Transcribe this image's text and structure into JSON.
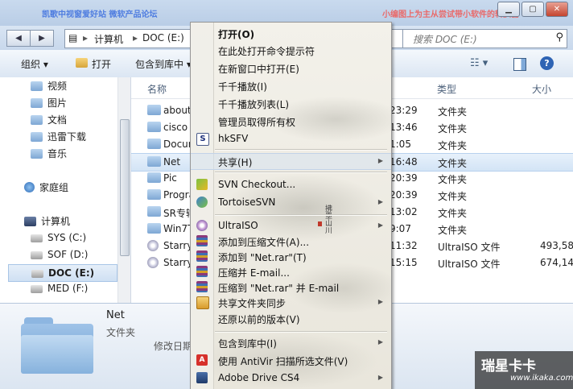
{
  "title_bar": {
    "left_text": "凯歌中视窗爱好站 微软产品论坛",
    "right_text": "小编图上为主从尝试带小软件的转换器",
    "minimize": "▁",
    "maximize": "▢",
    "close": "✕"
  },
  "address": {
    "back": "◀",
    "forward": "▶",
    "crumbs": [
      "计算机",
      "DOC (E:)"
    ],
    "search_placeholder": "搜索 DOC (E:)"
  },
  "toolbar": {
    "organize": "组织 ▾",
    "open": "打开",
    "include_in_library": "包含到库中 ▾"
  },
  "nav": {
    "items": [
      {
        "label": "视频",
        "kind": "folder"
      },
      {
        "label": "图片",
        "kind": "folder"
      },
      {
        "label": "文档",
        "kind": "folder"
      },
      {
        "label": "迅雷下载",
        "kind": "folder"
      },
      {
        "label": "音乐",
        "kind": "folder"
      },
      {
        "label": "家庭组",
        "kind": "homegroup"
      },
      {
        "label": "计算机",
        "kind": "computer"
      },
      {
        "label": "SYS (C:)",
        "kind": "drive"
      },
      {
        "label": "SOF (D:)",
        "kind": "drive"
      },
      {
        "label": "DOC (E:)",
        "kind": "drive",
        "selected": true
      },
      {
        "label": "MED (F:)",
        "kind": "drive"
      }
    ]
  },
  "files": {
    "columns": {
      "name": "名称",
      "type": "类型",
      "size": "大小"
    },
    "rows": [
      {
        "name": "about",
        "time": "23:29",
        "type": "文件夹",
        "size": "",
        "kind": "folder"
      },
      {
        "name": "cisco i",
        "time": "13:46",
        "type": "文件夹",
        "size": "",
        "kind": "folder"
      },
      {
        "name": "Docur",
        "time": "1:05",
        "type": "文件夹",
        "size": "",
        "kind": "folder"
      },
      {
        "name": "Net",
        "time": "16:48",
        "type": "文件夹",
        "size": "",
        "kind": "folder",
        "selected": true
      },
      {
        "name": "Pic",
        "time": "20:39",
        "type": "文件夹",
        "size": "",
        "kind": "folder"
      },
      {
        "name": "Progra",
        "time": "20:39",
        "type": "文件夹",
        "size": "",
        "kind": "folder"
      },
      {
        "name": "SR专输",
        "time": "13:02",
        "type": "文件夹",
        "size": "",
        "kind": "folder"
      },
      {
        "name": "Win7T",
        "time": "9:07",
        "type": "文件夹",
        "size": "",
        "kind": "folder"
      },
      {
        "name": "Starry.",
        "time": "11:32",
        "type": "UltraISO 文件",
        "size": "493,58",
        "kind": "iso"
      },
      {
        "name": "Starry.",
        "time": "15:15",
        "type": "UltraISO 文件",
        "size": "674,14",
        "kind": "iso"
      }
    ]
  },
  "details": {
    "name": "Net",
    "type": "文件夹",
    "modified_label": "修改日期"
  },
  "context_menu": {
    "items": [
      {
        "label": "打开(O)",
        "bold": true
      },
      {
        "label": "在此处打开命令提示符"
      },
      {
        "label": "在新窗口中打开(E)"
      },
      {
        "label": "千千播放(I)"
      },
      {
        "label": "千千播放列表(L)"
      },
      {
        "label": "管理员取得所有权"
      },
      {
        "label": "hkSFV",
        "icon": "hksfv-icon"
      },
      {
        "label": "共享(H)",
        "submenu": true,
        "hover": true
      },
      {
        "label": "SVN Checkout...",
        "icon": "svn-checkout-icon"
      },
      {
        "label": "TortoiseSVN",
        "icon": "tortoisesvn-icon",
        "submenu": true
      },
      {
        "label": "UltraISO",
        "icon": "ultraiso-icon",
        "submenu": true
      },
      {
        "label": "添加到压缩文件(A)...",
        "icon": "winrar-icon"
      },
      {
        "label": "添加到 \"Net.rar\"(T)",
        "icon": "winrar-icon"
      },
      {
        "label": "压缩并 E-mail...",
        "icon": "winrar-icon"
      },
      {
        "label": "压缩到 \"Net.rar\" 并 E-mail",
        "icon": "winrar-icon"
      },
      {
        "label": "共享文件夹同步",
        "icon": "sync-icon",
        "submenu": true
      },
      {
        "label": "还原以前的版本(V)"
      },
      {
        "label": "包含到库中(I)",
        "submenu": true
      },
      {
        "label": "使用 AntiVir 扫描所选文件(V)",
        "icon": "antivir-icon"
      },
      {
        "label": "Adobe Drive CS4",
        "icon": "adobe-drive-icon",
        "submenu": true
      }
    ],
    "painting_caption": "拂墨山川"
  },
  "watermark": {
    "title": "瑞星卡卡",
    "url": "www.ikaka.com"
  },
  "colors": {
    "accent": "#3b74c2",
    "folder": "#7ea7d4",
    "menu_bg": "#f0efe9"
  }
}
